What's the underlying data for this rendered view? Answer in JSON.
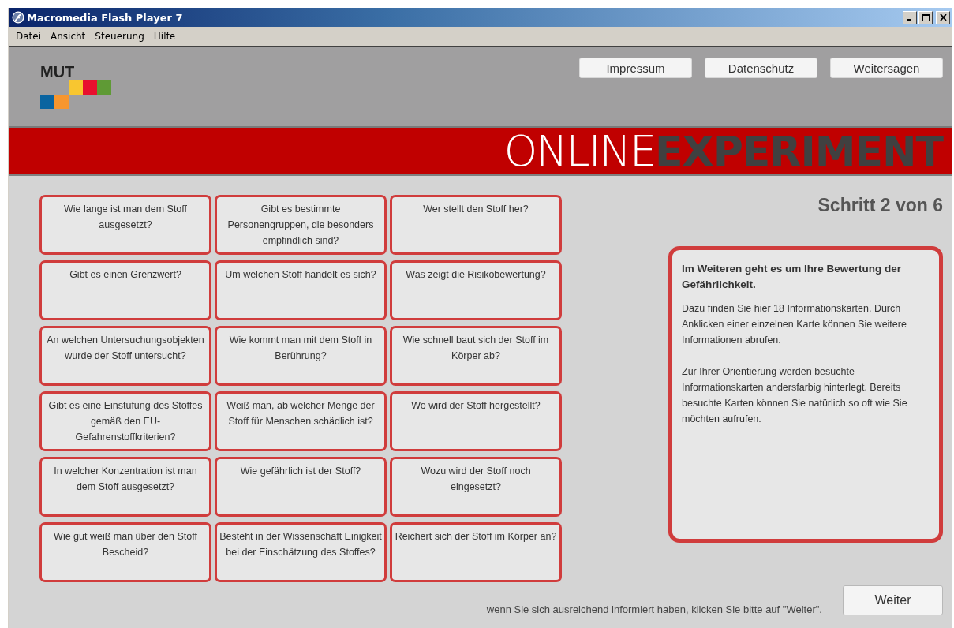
{
  "window": {
    "title": "Macromedia Flash Player 7"
  },
  "menu": [
    "Datei",
    "Ansicht",
    "Steuerung",
    "Hilfe"
  ],
  "header": {
    "logo": "MUT",
    "links": [
      "Impressum",
      "Datenschutz",
      "Weitersagen"
    ]
  },
  "banner": {
    "light": "ONLINE",
    "bold": "EXPERIMENT"
  },
  "step": "Schritt 2 von 6",
  "cards": [
    {
      "text": "Wie lange ist man dem Stoff ausgesetzt?"
    },
    {
      "text": "Gibt es bestimmte Personengruppen, die besonders empfindlich sind?"
    },
    {
      "text": "Wer stellt den Stoff her?"
    },
    {
      "text": "Gibt es einen Grenzwert?"
    },
    {
      "text": "Um welchen Stoff handelt es sich?"
    },
    {
      "text": "Was zeigt die Risikobewertung?"
    },
    {
      "text": "An welchen Untersuchungsobjekten wurde der Stoff untersucht?"
    },
    {
      "text": "Wie kommt man mit dem Stoff in Berührung?"
    },
    {
      "text": "Wie schnell baut sich der Stoff im Körper ab?"
    },
    {
      "text": "Gibt es eine Einstufung des Stoffes gemäß den EU-Gefahrenstoffkriterien?"
    },
    {
      "text": "Weiß man, ab welcher Menge der Stoff für Menschen schädlich ist?"
    },
    {
      "text": "Wo wird der Stoff hergestellt?"
    },
    {
      "text": "In welcher Konzentration ist man dem Stoff ausgesetzt?"
    },
    {
      "text": "Wie gefährlich ist der Stoff?"
    },
    {
      "text": "Wozu wird der Stoff noch eingesetzt?"
    },
    {
      "text": "Wie gut weiß man über den Stoff Bescheid?"
    },
    {
      "text": "Besteht in der Wissenschaft Einigkeit bei der Einschätzung des Stoffes?"
    },
    {
      "text": "Reichert sich der Stoff im Körper an?"
    }
  ],
  "info": {
    "heading": "Im Weiteren geht es um Ihre Bewertung der Gefährlichkeit.",
    "paragraphs": [
      "Dazu finden Sie hier 18 Informationskarten. Durch Anklicken einer einzelnen Karte können Sie weitere Informationen abrufen.",
      "Zur Ihrer Orientierung werden besuchte Informationskarten andersfarbig hinterlegt. Bereits besuchte Karten können Sie natürlich so oft wie Sie möchten aufrufen."
    ]
  },
  "footer": {
    "hint": "wenn Sie sich ausreichend informiert haben, klicken Sie bitte auf \"Weiter\".",
    "button": "Weiter"
  }
}
